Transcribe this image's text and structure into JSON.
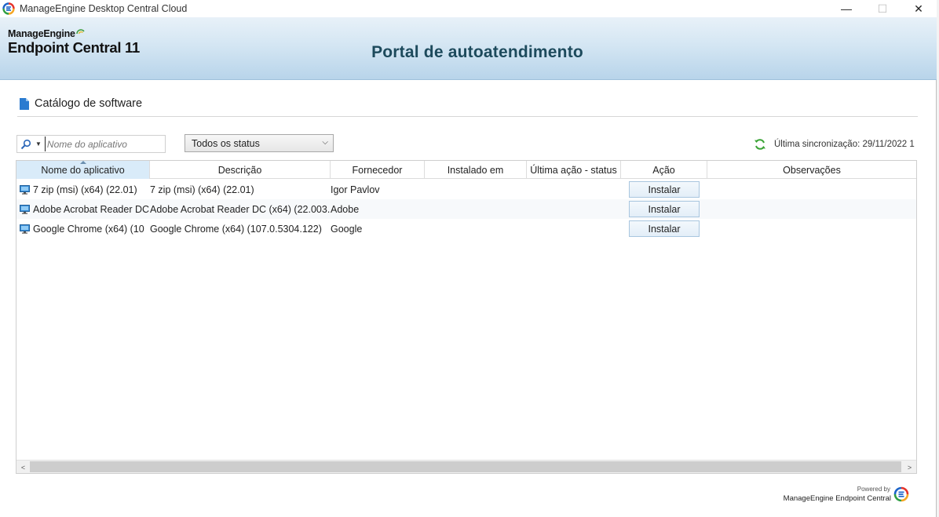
{
  "window": {
    "title": "ManageEngine Desktop Central Cloud",
    "minimize": "—",
    "maximize": "☐",
    "close": "✕"
  },
  "header": {
    "brand_top": "ManageEngine",
    "brand_product": "Endpoint Central 11",
    "portal_title": "Portal de autoatendimento"
  },
  "section": {
    "title": "Catálogo de software",
    "icon": "document-icon"
  },
  "toolbar": {
    "search_placeholder": "Nome do aplicativo",
    "search_value": "",
    "status_filter": "Todos os status",
    "sync_label": "Última sincronização: 29/11/2022 1"
  },
  "table": {
    "columns": [
      "Nome do aplicativo",
      "Descrição",
      "Fornecedor",
      "Instalado em",
      "Última ação - status",
      "Ação",
      "Observações"
    ],
    "sorted_column": "Nome do aplicativo",
    "rows": [
      {
        "name": "7 zip (msi) (x64) (22.01)",
        "description": "7 zip (msi) (x64) (22.01)",
        "vendor": "Igor Pavlov",
        "installed_on": "",
        "last_action": "",
        "action": "Instalar",
        "notes": ""
      },
      {
        "name": "Adobe Acrobat Reader DC",
        "description": "Adobe Acrobat Reader DC (x64) (22.003.",
        "vendor": "Adobe",
        "installed_on": "",
        "last_action": "",
        "action": "Instalar",
        "notes": ""
      },
      {
        "name": "Google Chrome (x64) (10",
        "description": "Google Chrome (x64) (107.0.5304.122)",
        "vendor": "Google",
        "installed_on": "",
        "last_action": "",
        "action": "Instalar",
        "notes": ""
      }
    ]
  },
  "scrollbar": {
    "left_arrow": "<",
    "right_arrow": ">"
  },
  "footer": {
    "powered_by": "Powered by",
    "product": "ManageEngine Endpoint Central"
  },
  "colors": {
    "portal_title": "#1d4a5c",
    "header_gradient_top": "#e8f1f8",
    "header_gradient_bottom": "#b8d4ea",
    "sorted_header": "#d9ebf9",
    "sync_icon": "#3aa335"
  }
}
